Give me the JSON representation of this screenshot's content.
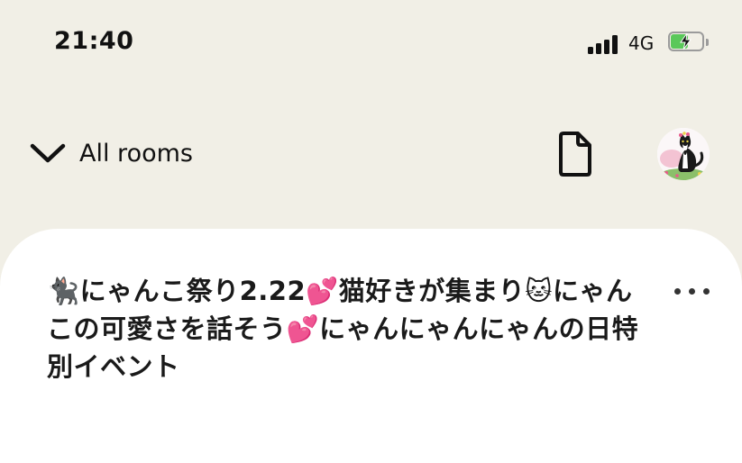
{
  "status_bar": {
    "time": "21:40",
    "network": "4G",
    "battery_level": 0.55,
    "battery_color": "#5ac85a"
  },
  "header": {
    "back_label": "All rooms",
    "back_icon": "chevron-down-icon",
    "document_icon": "document-icon",
    "avatar_alt": "cat avatar"
  },
  "room": {
    "title": "🐈‍⬛にゃんこ祭り2.22💕猫好きが集まり🐱にゃんこの可愛さを話そう💕にゃんにゃんにゃんの日特別イベント",
    "menu_icon": "more-horizontal-icon"
  },
  "colors": {
    "background": "#f1efe6",
    "card": "#ffffff",
    "text": "#111111"
  }
}
